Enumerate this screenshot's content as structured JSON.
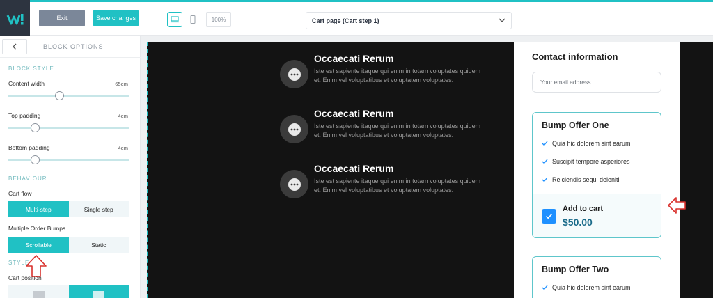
{
  "topbar": {
    "logo_icon": "brand-logo-icon",
    "exit_label": "Exit",
    "save_label": "Save changes",
    "zoom": "100%",
    "page_select": "Cart page (Cart step 1)"
  },
  "sidebar": {
    "title": "BLOCK OPTIONS",
    "block_style": "BLOCK STYLE",
    "content_width_label": "Content width",
    "content_width_value": "65em",
    "content_width_level": 0.42,
    "top_padding_label": "Top padding",
    "top_padding_value": "4em",
    "top_padding_level": 0.22,
    "bottom_padding_label": "Bottom padding",
    "bottom_padding_value": "4em",
    "bottom_padding_level": 0.22,
    "behaviour": "BEHAVIOUR",
    "cart_flow_label": "Cart flow",
    "cart_flow_options": [
      "Multi-step",
      "Single step"
    ],
    "cart_flow_selected": "Multi-step",
    "order_bumps_label": "Multiple Order Bumps",
    "order_bumps_options": [
      "Scrollable",
      "Static"
    ],
    "order_bumps_selected": "Scrollable",
    "style": "STYLE",
    "cart_position_label": "Cart position"
  },
  "features": [
    {
      "title": "Occaecati Rerum",
      "text": "Iste est sapiente itaque qui enim in totam voluptates quidem et. Enim vel voluptatibus et voluptatem voluptates."
    },
    {
      "title": "Occaecati Rerum",
      "text": "Iste est sapiente itaque qui enim in totam voluptates quidem et. Enim vel voluptatibus et voluptatem voluptates."
    },
    {
      "title": "Occaecati Rerum",
      "text": "Iste est sapiente itaque qui enim in totam voluptates quidem et. Enim vel voluptatibus et voluptatem voluptates."
    }
  ],
  "contact": {
    "title": "Contact information",
    "email_placeholder": "Your email address"
  },
  "bump_one": {
    "title": "Bump Offer One",
    "items": [
      "Quia hic dolorem sint earum",
      "Suscipit tempore asperiores",
      "Reiciendis sequi deleniti"
    ],
    "add_to_cart": "Add to cart",
    "price": "$50.00",
    "checked": true
  },
  "bump_two": {
    "title": "Bump Offer Two",
    "items": [
      "Quia hic dolorem sint earum"
    ]
  },
  "colors": {
    "accent": "#20c1c4",
    "annotation_arrow": "#d9302c",
    "canvas_bg": "#131313",
    "price": "#1a6b8a",
    "checkbox": "#1e90ff"
  }
}
